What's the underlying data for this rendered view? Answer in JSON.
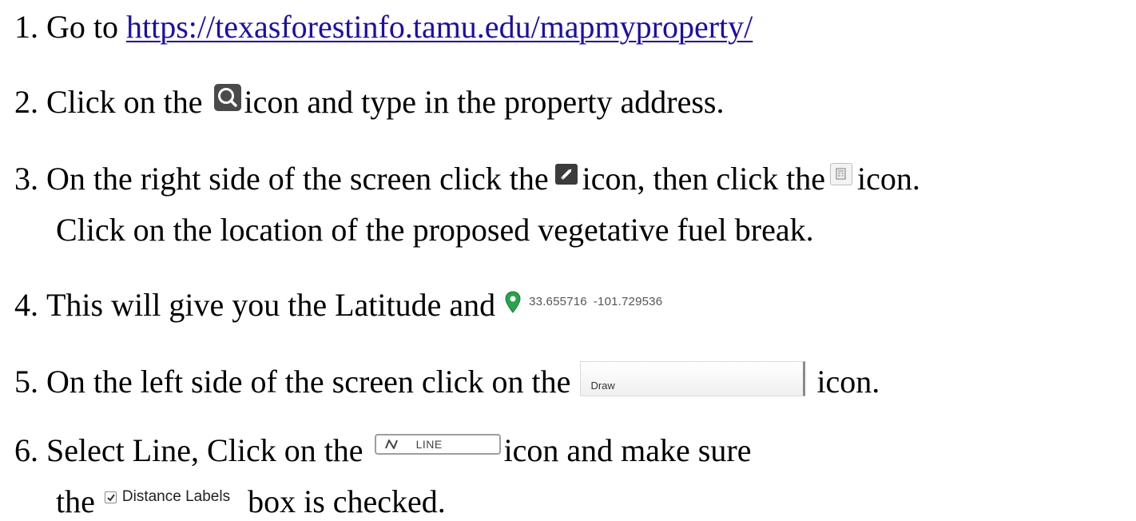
{
  "steps": [
    {
      "number": "1.",
      "text_before_link": "Go to",
      "link_text": "https://texasforestinfo.tamu.edu/mapmyproperty/"
    },
    {
      "number": "2.",
      "text_before_icon": "Click on the",
      "icon": "search-icon",
      "text_after_icon": "icon and type in the property address."
    },
    {
      "number": "3.",
      "text_before_icon": "On the right side of the screen click the",
      "icon": "pencil-icon",
      "text_middle": "icon, then click the",
      "icon2": "grid-icon",
      "text_after_icon": "icon.",
      "continuation": "Click on the location of the proposed vegetative fuel break."
    },
    {
      "number": "4.",
      "text_before_icon": "This will give you the Latitude and",
      "icon": "map-pin-icon",
      "latitude": "33.655716",
      "longitude": "-101.729536"
    },
    {
      "number": "5.",
      "text_before_icon": "On the left side of the screen click on the",
      "button_label": "Draw",
      "text_after_icon": "icon."
    },
    {
      "number": "6.",
      "text_before_icon": "Select Line, Click on the",
      "button_label": "LINE",
      "text_after_icon": "icon and make sure",
      "continuation_before": "the",
      "checkbox_label": "Distance Labels",
      "continuation_after": "box is checked."
    }
  ],
  "colors": {
    "link": "#1a0dab",
    "map_pin": "#2ba24c",
    "icon_dark": "#3b3b3b"
  }
}
